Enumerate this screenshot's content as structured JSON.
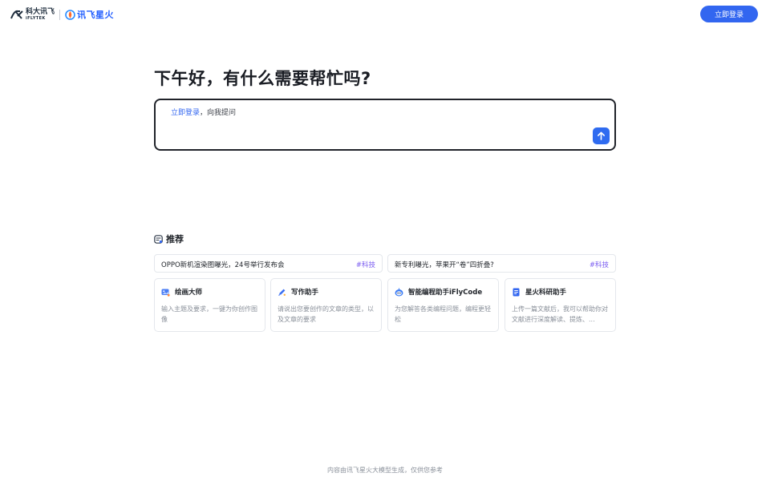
{
  "header": {
    "logo_ifly_cn": "科大讯飞",
    "logo_ifly_en": "iFLYTEK",
    "logo_spark": "讯飞星火",
    "login_button": "立即登录"
  },
  "greeting": "下午好，有什么需要帮忙吗?",
  "input": {
    "login_link": "立即登录",
    "prompt_rest": "，向我提问"
  },
  "recommend": {
    "title": "推荐",
    "news": [
      {
        "text": "OPPO新机渲染图曝光，24号举行发布会",
        "tag": "#科技"
      },
      {
        "text": "新专利曝光，苹果开“卷”四折叠?",
        "tag": "#科技"
      }
    ],
    "cards": [
      {
        "title": "绘画大师",
        "desc": "输入主题及要求，一键为你创作图像",
        "icon": "paint-icon"
      },
      {
        "title": "写作助手",
        "desc": "请说出您要创作的文章的类型，以及文章的要求",
        "icon": "pen-icon"
      },
      {
        "title": "智能编程助手iFlyCode",
        "desc": "为您解答各类编程问题，编程更轻松",
        "icon": "code-icon"
      },
      {
        "title": "星火科研助手",
        "desc": "上传一篇文献后，我可以帮助你对文献进行深度解读、提炼、...",
        "icon": "document-icon"
      }
    ]
  },
  "footer": "内容由讯飞星火大模型生成，仅供您参考",
  "colors": {
    "accent": "#3266f0",
    "tag": "#7a5cf0"
  }
}
